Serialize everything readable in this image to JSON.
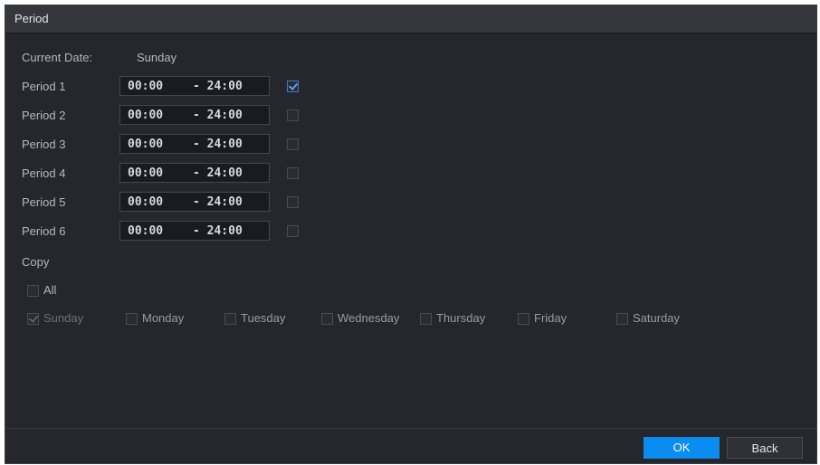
{
  "title": "Period",
  "current_date": {
    "label": "Current Date:",
    "value": "Sunday"
  },
  "periods": [
    {
      "label": "Period 1",
      "start": "00:00",
      "end": "- 24:00",
      "enabled": true
    },
    {
      "label": "Period 2",
      "start": "00:00",
      "end": "- 24:00",
      "enabled": false
    },
    {
      "label": "Period 3",
      "start": "00:00",
      "end": "- 24:00",
      "enabled": false
    },
    {
      "label": "Period 4",
      "start": "00:00",
      "end": "- 24:00",
      "enabled": false
    },
    {
      "label": "Period 5",
      "start": "00:00",
      "end": "- 24:00",
      "enabled": false
    },
    {
      "label": "Period 6",
      "start": "00:00",
      "end": "- 24:00",
      "enabled": false
    }
  ],
  "copy": {
    "label": "Copy",
    "all_label": "All",
    "days": [
      {
        "label": "Sunday",
        "checked": true,
        "disabled": true
      },
      {
        "label": "Monday",
        "checked": false,
        "disabled": false
      },
      {
        "label": "Tuesday",
        "checked": false,
        "disabled": false
      },
      {
        "label": "Wednesday",
        "checked": false,
        "disabled": false
      },
      {
        "label": "Thursday",
        "checked": false,
        "disabled": false
      },
      {
        "label": "Friday",
        "checked": false,
        "disabled": false
      },
      {
        "label": "Saturday",
        "checked": false,
        "disabled": false
      }
    ]
  },
  "buttons": {
    "ok_label": "OK",
    "back_label": "Back"
  },
  "colors": {
    "background": "#25272d",
    "titlebar": "#35373d",
    "accent": "#0a8cf0"
  }
}
